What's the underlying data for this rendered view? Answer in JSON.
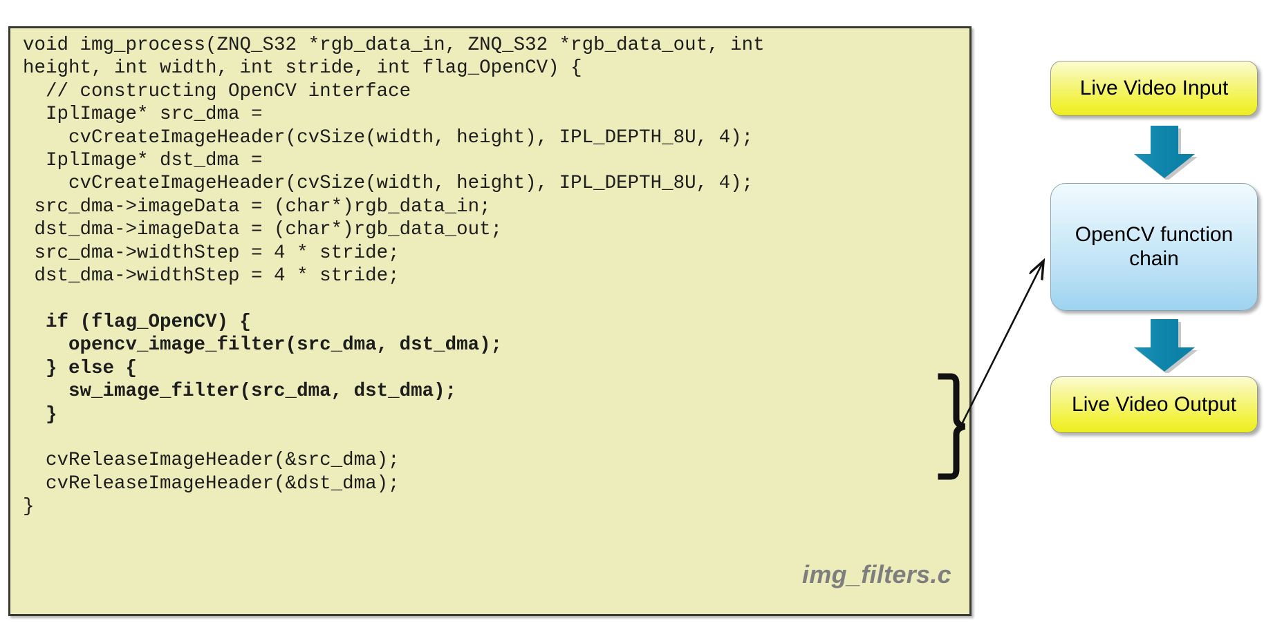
{
  "code_panel": {
    "file_label": "img_filters.c",
    "background_color": "#EDEDBC",
    "border_color": "#3A3A32",
    "lines": [
      {
        "text": "void img_process(ZNQ_S32 *rgb_data_in, ZNQ_S32 *rgb_data_out, int",
        "bold": false
      },
      {
        "text": "height, int width, int stride, int flag_OpenCV) {",
        "bold": false
      },
      {
        "text": "  // constructing OpenCV interface",
        "bold": false
      },
      {
        "text": "  IplImage* src_dma =",
        "bold": false
      },
      {
        "text": "    cvCreateImageHeader(cvSize(width, height), IPL_DEPTH_8U, 4);",
        "bold": false
      },
      {
        "text": "  IplImage* dst_dma =",
        "bold": false
      },
      {
        "text": "    cvCreateImageHeader(cvSize(width, height), IPL_DEPTH_8U, 4);",
        "bold": false
      },
      {
        "text": " src_dma->imageData = (char*)rgb_data_in;",
        "bold": false
      },
      {
        "text": " dst_dma->imageData = (char*)rgb_data_out;",
        "bold": false
      },
      {
        "text": " src_dma->widthStep = 4 * stride;",
        "bold": false
      },
      {
        "text": " dst_dma->widthStep = 4 * stride;",
        "bold": false
      },
      {
        "text": "",
        "bold": false
      },
      {
        "text": "  if (flag_OpenCV) {",
        "bold": true
      },
      {
        "text": "    opencv_image_filter(src_dma, dst_dma);",
        "bold": true
      },
      {
        "text": "  } else {",
        "bold": true
      },
      {
        "text": "    sw_image_filter(src_dma, dst_dma);",
        "bold": true
      },
      {
        "text": "  }",
        "bold": true
      },
      {
        "text": "",
        "bold": false
      },
      {
        "text": "  cvReleaseImageHeader(&src_dma);",
        "bold": false
      },
      {
        "text": "  cvReleaseImageHeader(&dst_dma);",
        "bold": false
      },
      {
        "text": "}",
        "bold": false
      }
    ]
  },
  "flow_diagram": {
    "arrow_color": "#1287AC",
    "boxes": [
      {
        "id": "input",
        "label": "Live Video Input",
        "fill": "#F2F23C"
      },
      {
        "id": "chain",
        "label": "OpenCV function\nchain",
        "fill": "#B6DEF4"
      },
      {
        "id": "output",
        "label": "Live Video Output",
        "fill": "#F2F23C"
      }
    ]
  },
  "annotation": {
    "brace_label": "}",
    "connector": "arrow-from-if-else-block-to-opencv-function-chain"
  }
}
